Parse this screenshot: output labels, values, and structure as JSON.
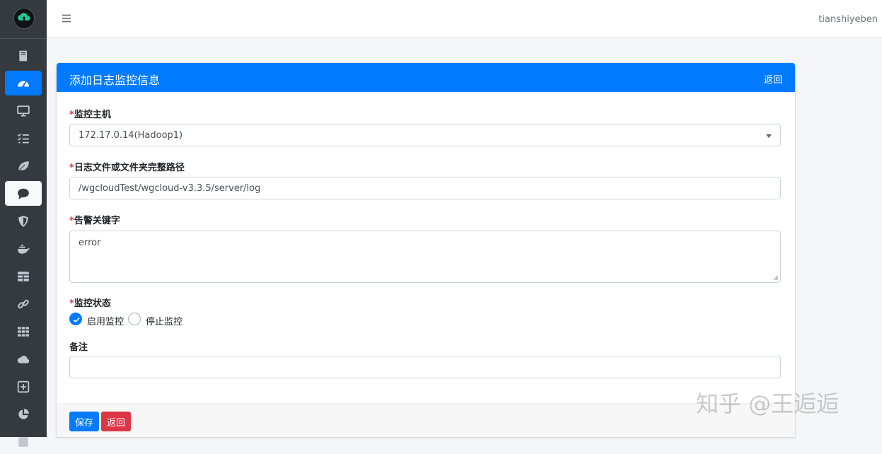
{
  "topbar": {
    "username": "tianshiyeben"
  },
  "sidebar": {
    "items": [
      {
        "icon": "book-icon"
      },
      {
        "icon": "dashboard-icon"
      },
      {
        "icon": "monitor-icon"
      },
      {
        "icon": "list-check-icon"
      },
      {
        "icon": "leaf-icon"
      },
      {
        "icon": "comment-icon"
      },
      {
        "icon": "shield-icon"
      },
      {
        "icon": "docker-icon"
      },
      {
        "icon": "table-icon"
      },
      {
        "icon": "link-icon"
      },
      {
        "icon": "grid-icon"
      },
      {
        "icon": "cloud-icon"
      },
      {
        "icon": "plus-square-icon"
      },
      {
        "icon": "pie-chart-icon"
      }
    ]
  },
  "card": {
    "title": "添加日志监控信息",
    "back_link": "返回",
    "host_label": "监控主机",
    "host_value": "172.17.0.14(Hadoop1)",
    "path_label": "日志文件或文件夹完整路径",
    "path_value": "/wgcloudTest/wgcloud-v3.3.5/server/log",
    "keyword_label": "告警关键字",
    "keyword_value": "error",
    "status_label": "监控状态",
    "status_on": "启用监控",
    "status_off": "停止监控",
    "remark_label": "备注",
    "remark_value": "",
    "save_label": "保存",
    "cancel_label": "返回"
  },
  "required_mark": "*",
  "watermark": "知乎 @王逅逅",
  "colors": {
    "primary": "#007bff",
    "danger": "#dc3545",
    "sidebar": "#343a40"
  }
}
